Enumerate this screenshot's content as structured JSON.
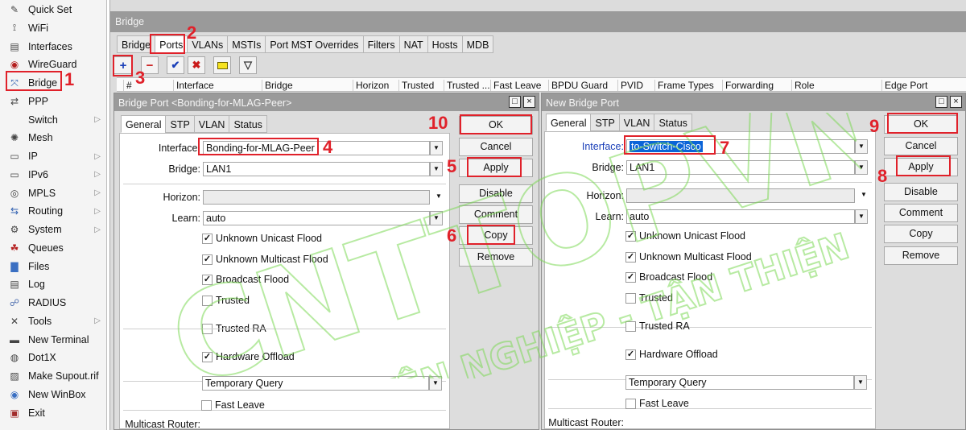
{
  "sidebar": {
    "items": [
      {
        "label": "Quick Set",
        "icon": "wand-icon",
        "sub": false
      },
      {
        "label": "WiFi",
        "icon": "antenna-icon",
        "sub": false
      },
      {
        "label": "Interfaces",
        "icon": "interfaces-icon",
        "sub": false
      },
      {
        "label": "WireGuard",
        "icon": "wireguard-icon",
        "sub": false
      },
      {
        "label": "Bridge",
        "icon": "bridge-icon",
        "sub": false
      },
      {
        "label": "PPP",
        "icon": "ppp-icon",
        "sub": false
      },
      {
        "label": "Switch",
        "icon": "switch-icon",
        "sub": true
      },
      {
        "label": "Mesh",
        "icon": "mesh-icon",
        "sub": false
      },
      {
        "label": "IP",
        "icon": "ip-icon",
        "sub": true
      },
      {
        "label": "IPv6",
        "icon": "ipv6-icon",
        "sub": true
      },
      {
        "label": "MPLS",
        "icon": "mpls-icon",
        "sub": true
      },
      {
        "label": "Routing",
        "icon": "routing-icon",
        "sub": true
      },
      {
        "label": "System",
        "icon": "system-gear-icon",
        "sub": true
      },
      {
        "label": "Queues",
        "icon": "queues-icon",
        "sub": false
      },
      {
        "label": "Files",
        "icon": "folder-icon",
        "sub": false
      },
      {
        "label": "Log",
        "icon": "log-icon",
        "sub": false
      },
      {
        "label": "RADIUS",
        "icon": "radius-icon",
        "sub": false
      },
      {
        "label": "Tools",
        "icon": "tools-icon",
        "sub": true
      },
      {
        "label": "New Terminal",
        "icon": "terminal-icon",
        "sub": false
      },
      {
        "label": "Dot1X",
        "icon": "dot1x-icon",
        "sub": false
      },
      {
        "label": "Make Supout.rif",
        "icon": "supout-icon",
        "sub": false
      },
      {
        "label": "New WinBox",
        "icon": "winbox-icon",
        "sub": false
      },
      {
        "label": "Exit",
        "icon": "exit-icon",
        "sub": false
      }
    ]
  },
  "bridge": {
    "title": "Bridge",
    "tabs": [
      "Bridge",
      "Ports",
      "VLANs",
      "MSTIs",
      "Port MST Overrides",
      "Filters",
      "NAT",
      "Hosts",
      "MDB"
    ],
    "toolbar": {
      "add": "+",
      "remove": "−",
      "enable": "✔",
      "disable": "✖",
      "comment": "▭",
      "filter": "▽"
    },
    "columns": [
      "#",
      "Interface",
      "Bridge",
      "Horizon",
      "Trusted",
      "Trusted ...",
      "Fast Leave",
      "BPDU Guard",
      "PVID",
      "Frame Types",
      "Forwarding",
      "Role",
      "Edge Port"
    ]
  },
  "dialog_left": {
    "title": "Bridge Port <Bonding-for-MLAG-Peer>",
    "tabs": [
      "General",
      "STP",
      "VLAN",
      "Status"
    ],
    "interface_label": "Interface:",
    "interface_value": "Bonding-for-MLAG-Peer",
    "bridge_label": "Bridge:",
    "bridge_value": "LAN1",
    "horizon_label": "Horizon:",
    "horizon_value": "",
    "learn_label": "Learn:",
    "learn_value": "auto",
    "checks": [
      {
        "label": "Unknown Unicast Flood",
        "checked": true
      },
      {
        "label": "Unknown Multicast Flood",
        "checked": true
      },
      {
        "label": "Broadcast Flood",
        "checked": true
      },
      {
        "label": "Trusted",
        "checked": false
      },
      {
        "label": "Trusted RA",
        "checked": false
      },
      {
        "label": "Hardware Offload",
        "checked": true
      }
    ],
    "mcast_label": "Multicast Router:",
    "mcast_value": "Temporary Query",
    "fast_leave_label": "Fast Leave",
    "buttons": [
      "OK",
      "Cancel",
      "Apply",
      "Disable",
      "Comment",
      "Copy",
      "Remove"
    ]
  },
  "dialog_right": {
    "title": "New Bridge Port",
    "tabs": [
      "General",
      "STP",
      "VLAN",
      "Status"
    ],
    "interface_label": "Interface:",
    "interface_value": "to-Switch-Cisco",
    "bridge_label": "Bridge:",
    "bridge_value": "LAN1",
    "horizon_label": "Horizon:",
    "horizon_value": "",
    "learn_label": "Learn:",
    "learn_value": "auto",
    "checks": [
      {
        "label": "Unknown Unicast Flood",
        "checked": true
      },
      {
        "label": "Unknown Multicast Flood",
        "checked": true
      },
      {
        "label": "Broadcast Flood",
        "checked": true
      },
      {
        "label": "Trusted",
        "checked": false
      },
      {
        "label": "Trusted RA",
        "checked": false
      },
      {
        "label": "Hardware Offload",
        "checked": true
      }
    ],
    "mcast_label": "Multicast Router:",
    "mcast_value": "Temporary Query",
    "fast_leave_label": "Fast Leave",
    "buttons": [
      "OK",
      "Cancel",
      "Apply",
      "Disable",
      "Comment",
      "Copy",
      "Remove"
    ]
  },
  "annotations": [
    "1",
    "2",
    "3",
    "4",
    "5",
    "6",
    "7",
    "8",
    "9",
    "10"
  ],
  "watermark": {
    "line1": "CNTTOPVN",
    "line2": "CHUYÊN NGHIỆP - TẬN THIỆN"
  },
  "colors": {
    "annotation_red": "#e0212a",
    "selection_blue": "#0a64d8",
    "titlebar_gray": "#9a9a9a",
    "watermark_green": "#7ed957"
  }
}
